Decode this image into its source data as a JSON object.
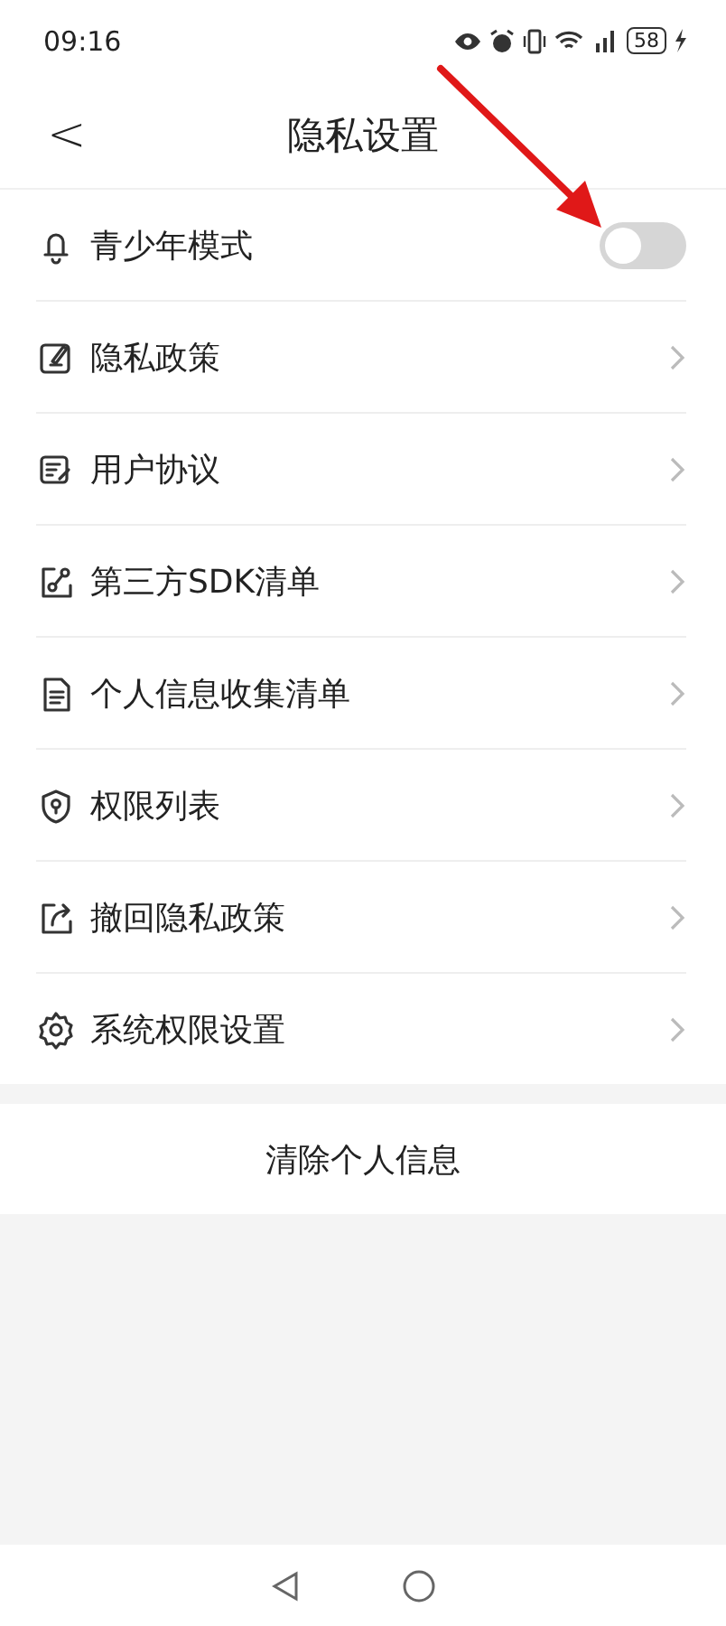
{
  "status_bar": {
    "time": "09:16",
    "battery": "58"
  },
  "header": {
    "back": "<",
    "title": "隐私设置"
  },
  "settings": [
    {
      "kind": "toggle",
      "label": "青少年模式",
      "on": false
    },
    {
      "kind": "link",
      "label": "隐私政策"
    },
    {
      "kind": "link",
      "label": "用户协议"
    },
    {
      "kind": "link",
      "label": "第三方SDK清单"
    },
    {
      "kind": "link",
      "label": "个人信息收集清单"
    },
    {
      "kind": "link",
      "label": "权限列表"
    },
    {
      "kind": "link",
      "label": "撤回隐私政策"
    },
    {
      "kind": "link",
      "label": "系统权限设置"
    }
  ],
  "clear_button": "清除个人信息"
}
